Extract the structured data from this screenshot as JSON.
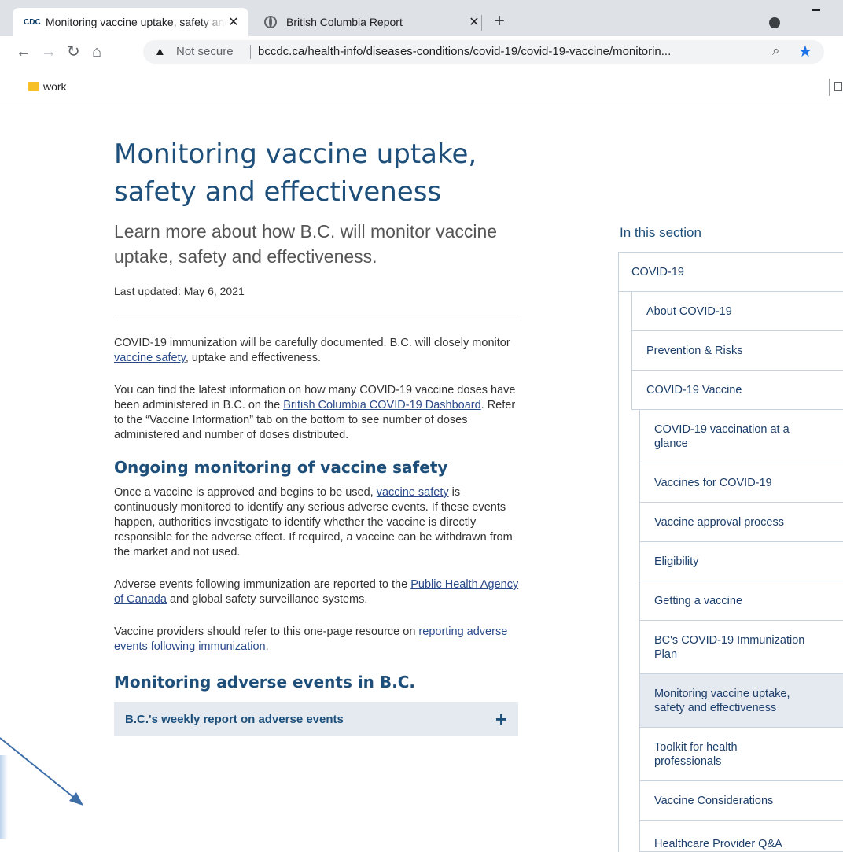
{
  "browser": {
    "tabs": [
      {
        "label": "Monitoring vaccine uptake, safety and effectiveness",
        "favicon_text": "CDC"
      },
      {
        "label": "British Columbia Report"
      }
    ],
    "new_tab_label": "+",
    "address": {
      "security_label": "Not secure",
      "url": "bccdc.ca/health-info/diseases-conditions/covid-19/covid-19-vaccine/monitorin..."
    },
    "bookmarks": [
      {
        "label": "work"
      }
    ]
  },
  "page": {
    "title": "Monitoring vaccine uptake, safety and effectiveness",
    "lede": "Learn more about how B.C. will monitor vaccine uptake, safety and effectiveness.",
    "last_updated": "Last updated: May 6, 2021",
    "p1": {
      "before": "COVID-19 immunization will be carefully documented. B.C. will closely monitor ",
      "link": "vaccine safety",
      "after": ", uptake and effectiveness."
    },
    "p2": {
      "before": "You can find the latest information on how many COVID-19 vaccine doses have been administered in B.C. on the ",
      "link": "British Columbia COVID-19 Dashboard",
      "after": ". Refer to the “Vaccine Information” tab on the bottom to see number of doses administered and number of doses distributed."
    },
    "h2_safety": "Ongoing monitoring of vaccine safety",
    "p3": {
      "before": "Once a vaccine is approved and begins to be used, ",
      "link": "vaccine safety",
      "after": " is continuously monitored to identify any serious adverse events.  If these events happen, authorities investigate to identify whether the vaccine is directly responsible for the adverse effect. If required, a vaccine can be withdrawn from the market and not used."
    },
    "p4": {
      "before": "Adverse events following immunization are reported to the ",
      "link": "Public Health Agency of Canada",
      "after": " and global safety surveillance systems."
    },
    "p5": {
      "before": "Vaccine providers should refer to this one-page resource on ",
      "link": "reporting adverse events following immunization",
      "after": "."
    },
    "h2_adverse": "Monitoring adverse events in B.C.",
    "accordion": {
      "label": "B.C.'s weekly report on adverse events",
      "toggle": "+"
    }
  },
  "sidebar": {
    "title": "In this section",
    "items": [
      {
        "label": "COVID-19"
      },
      {
        "label": "About COVID-19"
      },
      {
        "label": "Prevention & Risks"
      },
      {
        "label": "COVID-19 Vaccine"
      },
      {
        "label": "COVID-19 vaccination at a glance"
      },
      {
        "label": "Vaccines for COVID-19"
      },
      {
        "label": "Vaccine approval process"
      },
      {
        "label": "Eligibility"
      },
      {
        "label": "Getting a vaccine"
      },
      {
        "label": "BC's COVID-19 Immunization Plan"
      },
      {
        "label": "Monitoring vaccine uptake, safety and effectiveness"
      },
      {
        "label": "Toolkit for health professionals"
      },
      {
        "label": "Vaccine Considerations"
      },
      {
        "label": "Healthcare Provider Q&A"
      }
    ]
  },
  "colors": {
    "accent": "#1d4f7a",
    "active_item": "#e5eaf0",
    "arrow": "#3d6ea8"
  }
}
